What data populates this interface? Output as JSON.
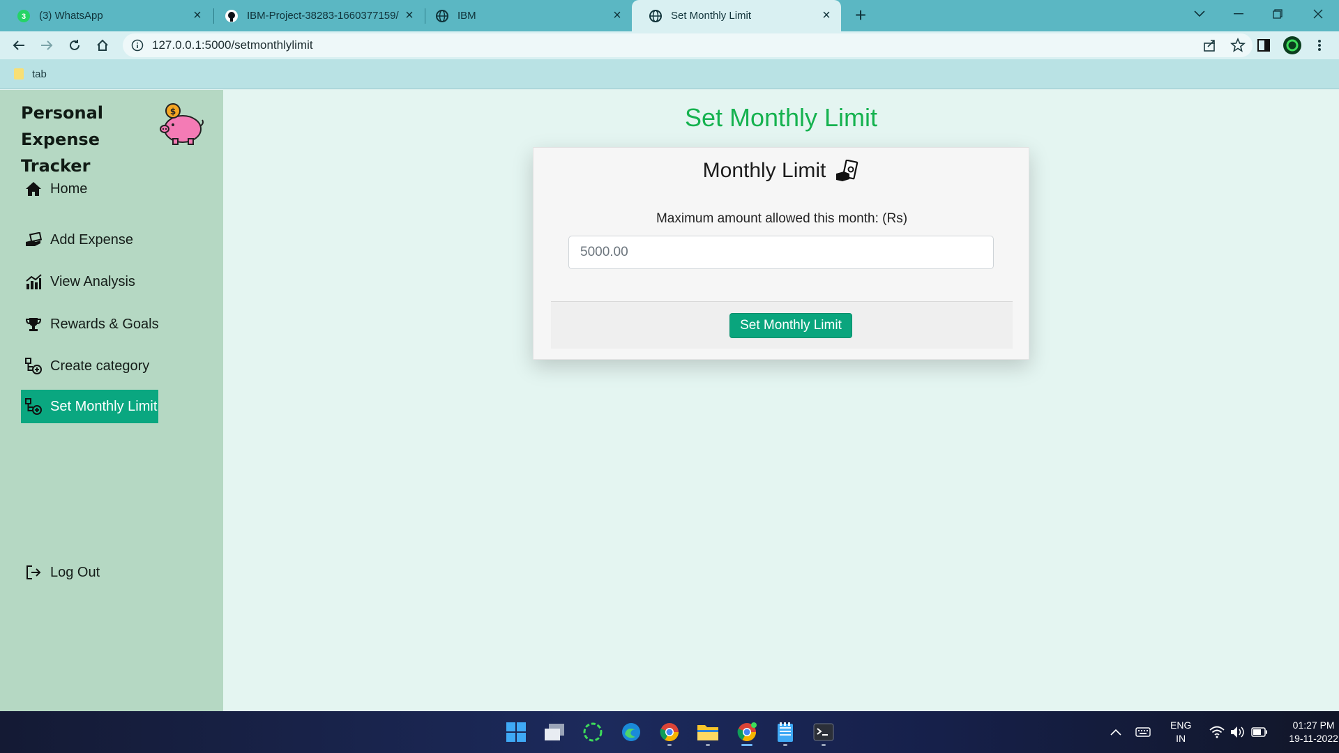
{
  "browser": {
    "tabs": [
      {
        "title": "(3) WhatsApp",
        "icon": "whatsapp-icon",
        "active": false
      },
      {
        "title": "IBM-Project-38283-1660377159/",
        "icon": "github-icon",
        "active": false
      },
      {
        "title": "IBM",
        "icon": "globe-icon",
        "active": false
      },
      {
        "title": "Set Monthly Limit",
        "icon": "globe-icon",
        "active": true
      }
    ],
    "url": "127.0.0.1:5000/setmonthlylimit",
    "bookmarks": [
      {
        "label": "tab"
      }
    ]
  },
  "sidebar": {
    "brand": "Personal Expense Tracker",
    "items": [
      {
        "label": "Home",
        "icon": "home-icon"
      },
      {
        "label": "Add Expense",
        "icon": "cash-hand-icon"
      },
      {
        "label": "View Analysis",
        "icon": "chart-icon"
      },
      {
        "label": "Rewards & Goals",
        "icon": "trophy-icon"
      },
      {
        "label": "Create category",
        "icon": "category-add-icon"
      },
      {
        "label": "Set Monthly Limit",
        "icon": "category-add-icon",
        "active": true
      }
    ],
    "logout": {
      "label": "Log Out",
      "icon": "logout-icon"
    }
  },
  "main": {
    "page_title": "Set Monthly Limit",
    "card": {
      "title": "Monthly Limit",
      "field_label": "Maximum amount allowed this month: (Rs)",
      "input_placeholder": "5000.00",
      "submit_label": "Set Monthly Limit"
    }
  },
  "taskbar": {
    "apps": [
      "start-icon",
      "task-view-icon",
      "app-icon",
      "edge-icon",
      "chrome-icon",
      "file-explorer-icon",
      "chrome-icon",
      "notepad-icon",
      "terminal-icon"
    ],
    "language": "ENG",
    "region": "IN",
    "time": "01:27 PM",
    "date": "19-11-2022"
  },
  "colors": {
    "accent": "#0aa780",
    "title_green": "#15b24f",
    "sidebar_bg": "#b5d8c3",
    "main_bg": "#e4f5f1",
    "tabbar_bg": "#5bb7c3"
  }
}
